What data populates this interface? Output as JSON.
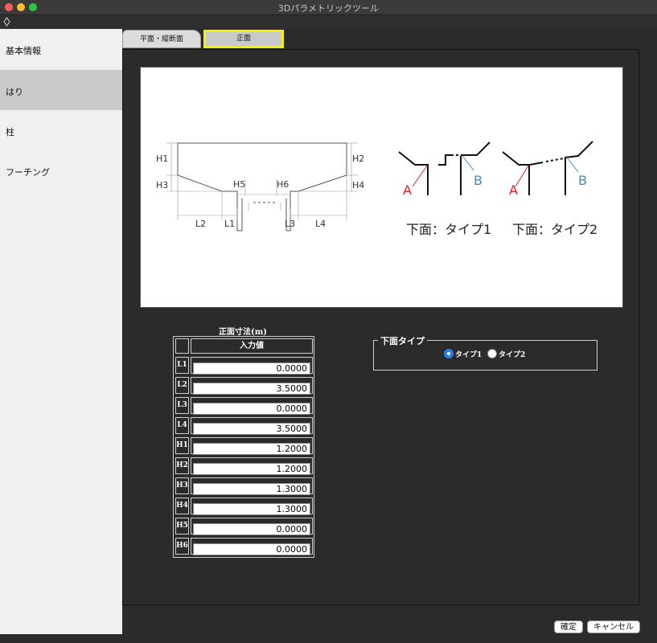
{
  "window": {
    "title": "3Dパラメトリックツール"
  },
  "sidebar": {
    "items": [
      {
        "label": "基本情報",
        "active": false
      },
      {
        "label": "はり",
        "active": true
      },
      {
        "label": "柱",
        "active": false
      },
      {
        "label": "フーチング",
        "active": false
      }
    ]
  },
  "tabs": [
    {
      "label": "平面・縦断面",
      "active": false
    },
    {
      "label": "正面",
      "active": true
    }
  ],
  "diagram": {
    "dim_labels": [
      "H1",
      "H2",
      "H3",
      "H4",
      "H5",
      "H6",
      "L2",
      "L1",
      "L3",
      "L4"
    ],
    "type1_caption": "下面：タイプ1",
    "type2_caption": "下面：タイプ2",
    "point_a": "A",
    "point_b": "B",
    "colors": {
      "a": "#e02020",
      "b": "#3a8fd8"
    }
  },
  "table": {
    "caption": "正面寸法(m)",
    "header": "入力値",
    "rows": [
      {
        "label": "L1",
        "value": "0.0000"
      },
      {
        "label": "L2",
        "value": "3.5000"
      },
      {
        "label": "L3",
        "value": "0.0000"
      },
      {
        "label": "L4",
        "value": "3.5000"
      },
      {
        "label": "H1",
        "value": "1.2000"
      },
      {
        "label": "H2",
        "value": "1.2000"
      },
      {
        "label": "H3",
        "value": "1.3000"
      },
      {
        "label": "H4",
        "value": "1.3000"
      },
      {
        "label": "H5",
        "value": "0.0000"
      },
      {
        "label": "H6",
        "value": "0.0000"
      }
    ]
  },
  "bottom_type": {
    "legend": "下面タイプ",
    "options": [
      "タイプ1",
      "タイプ2"
    ],
    "selected": "タイプ1"
  },
  "buttons": {
    "ok": "確定",
    "cancel": "キャンセル"
  },
  "colors": {
    "active_tab_border": "#f5f200",
    "radio_selected": "#2a7de1"
  }
}
